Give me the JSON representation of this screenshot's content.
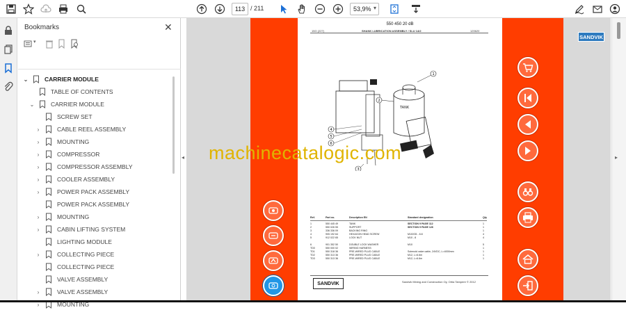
{
  "toolbar": {
    "page_current": "113",
    "page_total": "/  211",
    "zoom": "53,9%"
  },
  "bookmarks": {
    "title": "Bookmarks",
    "close": "✕",
    "items": [
      {
        "label": "CARRIER MODULE",
        "chevron": "⌄"
      },
      {
        "label": "TABLE OF CONTENTS",
        "chevron": ""
      },
      {
        "label": "CARRIER MODULE",
        "chevron": "⌄"
      },
      {
        "label": "SCREW SET",
        "chevron": ""
      },
      {
        "label": "CABLE REEL ASSEMBLY",
        "chevron": "›"
      },
      {
        "label": "MOUNTING",
        "chevron": "›"
      },
      {
        "label": "COMPRESSOR",
        "chevron": "›"
      },
      {
        "label": "COMPRESSOR ASSEMBLY",
        "chevron": "›"
      },
      {
        "label": "COOLER ASSEMBLY",
        "chevron": "›"
      },
      {
        "label": "POWER PACK ASSEMBLY",
        "chevron": "›"
      },
      {
        "label": "POWER PACK ASSEMBLY",
        "chevron": ""
      },
      {
        "label": "MOUNTING",
        "chevron": "›"
      },
      {
        "label": "CABIN LIFTING SYSTEM",
        "chevron": "›"
      },
      {
        "label": "LIGHTING MODULE",
        "chevron": ""
      },
      {
        "label": "COLLECTING PIECE",
        "chevron": "›"
      },
      {
        "label": "COLLECTING PIECE",
        "chevron": ""
      },
      {
        "label": "VALVE ASSEMBLY",
        "chevron": ""
      },
      {
        "label": "VALVE ASSEMBLY",
        "chevron": "›"
      },
      {
        "label": "MOUNTING",
        "chevron": "›"
      }
    ]
  },
  "document": {
    "part_number": "550 450 20 dB",
    "title": "SHANK LUBRICATION ASSEMBLY / SLU 14/2",
    "left_code": "15G (227)",
    "right_code": "120620",
    "tank_label": "TANK",
    "callouts": [
      "1",
      "2",
      "3",
      "4",
      "5",
      "6"
    ],
    "table_header": {
      "ref": "Ref.",
      "part": "Part no.",
      "desc": "Description EN",
      "std": "Standard designation",
      "qty": "Qty"
    },
    "table_rows": [
      {
        "ref": "1",
        "part": "550 445 49",
        "desc": "TANK",
        "std": "SECTION 9 PAGE 112",
        "qty": "1"
      },
      {
        "ref": "2",
        "part": "550 026 55",
        "desc": "SUPPORT",
        "std": "SECTION 9 PAGE 126",
        "qty": "1"
      },
      {
        "ref": "3",
        "part": "336 336 09",
        "desc": "BACKING RING",
        "std": "",
        "qty": "1"
      },
      {
        "ref": "4",
        "part": "905 192 64",
        "desc": "HEXAGON HEAD SCREW",
        "std": "M10X35 - 8.8",
        "qty": "4"
      },
      {
        "ref": "5",
        "part": "912 022 65",
        "desc": "LOCK NUT",
        "std": "M10 - 8",
        "qty": "4"
      },
      {
        "ref": "6",
        "part": "901 352 50",
        "desc": "DOUBLE LOCK WASHER",
        "std": "M10",
        "qty": "5"
      },
      {
        "ref": "TD0",
        "part": "550 000 02",
        "desc": "WIRING HARNESS",
        "std": "",
        "qty": "1"
      },
      {
        "ref": "TD1",
        "part": "550 318 36",
        "desc": "PRE-WIRED PLUG CABLE",
        "std": "Solenoid valve cable, 24VDC, L=4000mm",
        "qty": "1"
      },
      {
        "ref": "TD2",
        "part": "550 313 36",
        "desc": "PRE-WIRED PLUG CABLE",
        "std": "M12, L=6.6m",
        "qty": "1"
      },
      {
        "ref": "TD3",
        "part": "550 313 36",
        "desc": "PRE-WIRED PLUG CABLE",
        "std": "M12, L=6.6m",
        "qty": "1"
      }
    ],
    "footer_logo": "SANDVIK",
    "footer_text": "Sandvik Mining and Construction Oy, Ortia Tampere © 2012"
  },
  "brand_logo": "SANDVIK",
  "watermark": "machinecatalogic.com",
  "colors": {
    "band": "#ff3d00",
    "button": "#ff6a3d",
    "accent_blue": "#2196e6",
    "watermark": "#e0b400"
  }
}
